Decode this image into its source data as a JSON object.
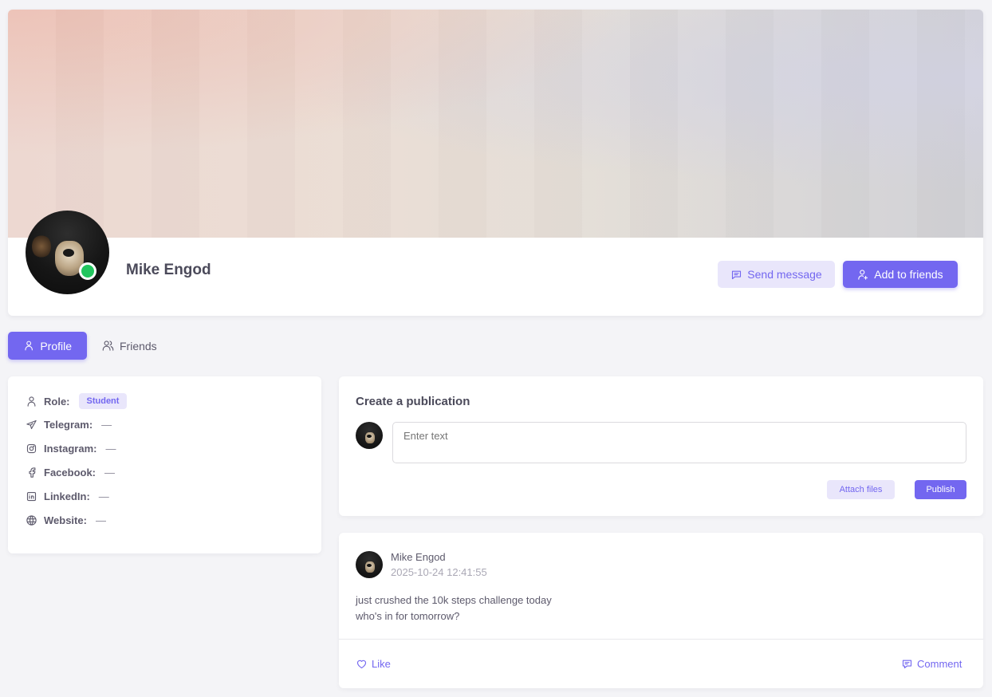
{
  "profile": {
    "name": "Mike Engod",
    "online": true,
    "send_message_label": "Send message",
    "add_friends_label": "Add to friends"
  },
  "tabs": [
    {
      "label": "Profile",
      "active": true
    },
    {
      "label": "Friends",
      "active": false
    }
  ],
  "about": {
    "role_label": "Role:",
    "role_value": "Student",
    "telegram_label": "Telegram:",
    "telegram_value": "—",
    "instagram_label": "Instagram:",
    "instagram_value": "—",
    "facebook_label": "Facebook:",
    "facebook_value": "—",
    "linkedin_label": "LinkedIn:",
    "linkedin_value": "—",
    "website_label": "Website:",
    "website_value": "—"
  },
  "create_post": {
    "title": "Create a publication",
    "placeholder": "Enter text",
    "attach_label": "Attach files",
    "publish_label": "Publish"
  },
  "post": {
    "author": "Mike Engod",
    "timestamp": "2025-10-24 12:41:55",
    "line1": "just crushed the 10k steps challenge today",
    "line2": "who's in for tomorrow?",
    "like_label": "Like",
    "comment_label": "Comment"
  },
  "colors": {
    "accent": "#7367f0",
    "accent_light": "#e9e6fb",
    "online": "#22c55e"
  }
}
